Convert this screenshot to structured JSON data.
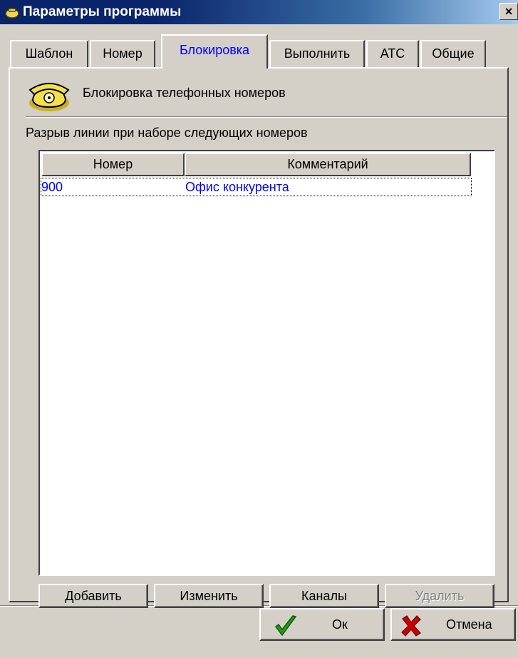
{
  "window": {
    "title": "Параметры программы",
    "close_glyph": "×",
    "app_icon": "phone-icon"
  },
  "tabs": [
    {
      "label": "Шаблон",
      "active": false
    },
    {
      "label": "Номер",
      "active": false
    },
    {
      "label": "Блокировка",
      "active": true
    },
    {
      "label": "Выполнить",
      "active": false
    },
    {
      "label": "АТС",
      "active": false
    },
    {
      "label": "Общие",
      "active": false
    }
  ],
  "panel": {
    "header_icon": "telephone-icon",
    "header_title": "Блокировка телефонных номеров",
    "list_caption": "Разрыв линии при наборе следующих номеров"
  },
  "table": {
    "columns": [
      "Номер",
      "Комментарий"
    ],
    "rows": [
      {
        "number": "900",
        "comment": "Офис конкурента"
      }
    ]
  },
  "list_buttons": {
    "add": "Добавить",
    "edit": "Изменить",
    "channels": "Каналы",
    "delete": "Удалить"
  },
  "dialog_buttons": {
    "ok": "Ок",
    "cancel": "Отмена"
  },
  "colors": {
    "accent_text": "#0000ff",
    "titlebar": "#0a246a",
    "ok_check": "#2a9a1a",
    "cancel_x": "#cc0000"
  }
}
